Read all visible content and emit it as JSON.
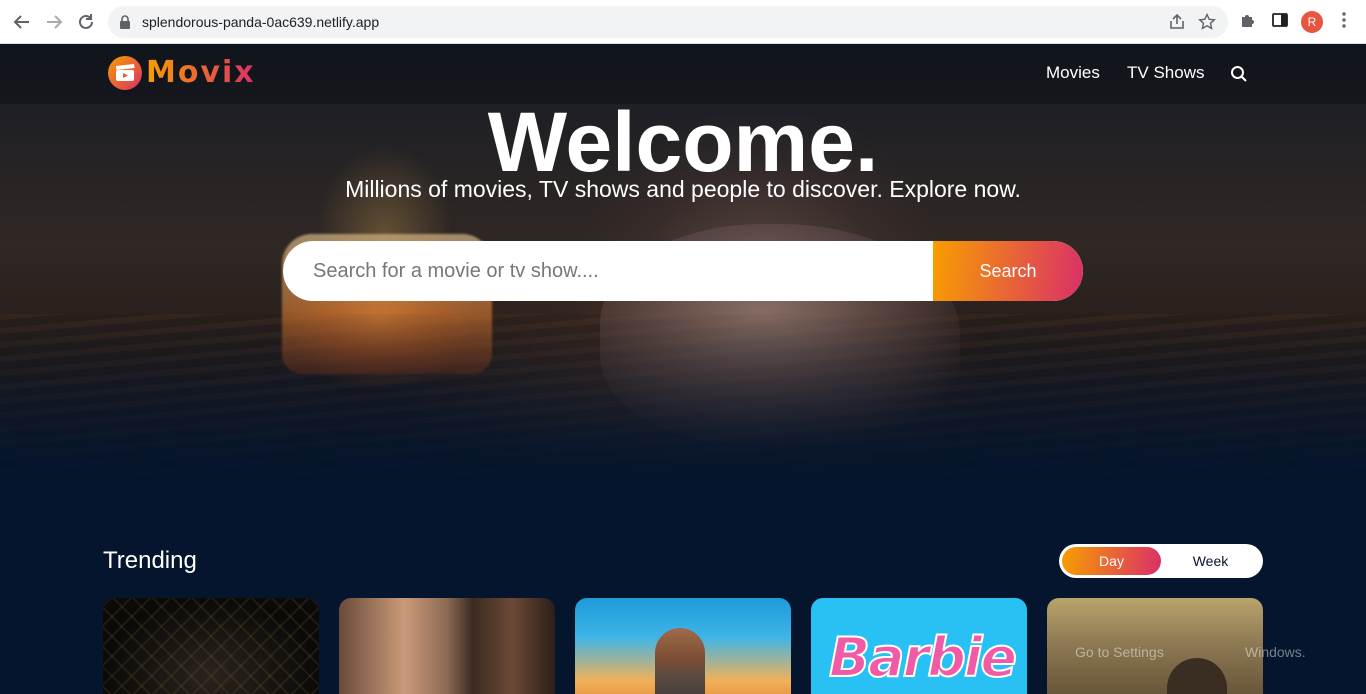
{
  "browser": {
    "url": "splendorous-panda-0ac639.netlify.app",
    "profile_initial": "R"
  },
  "header": {
    "logo_text": "Movix",
    "nav": {
      "movies": "Movies",
      "tv_shows": "TV Shows"
    }
  },
  "hero": {
    "title": "Welcome.",
    "subtitle": "Millions of movies, TV shows and people to discover. Explore now.",
    "search_placeholder": "Search for a movie or tv show....",
    "search_button": "Search"
  },
  "trending": {
    "title": "Trending",
    "switch": {
      "day": "Day",
      "week": "Week",
      "selected": "Day"
    },
    "cards": [
      {
        "id": "card-1"
      },
      {
        "id": "card-2"
      },
      {
        "id": "card-3"
      },
      {
        "id": "card-4",
        "poster_text": "Barbie"
      },
      {
        "id": "card-5"
      }
    ]
  },
  "overlay": {
    "watermark_left": "Go to Settings",
    "watermark_right": "Windows."
  },
  "colors": {
    "background": "#04152d",
    "gradient_start": "#f89e00",
    "gradient_end": "#da2f68"
  }
}
